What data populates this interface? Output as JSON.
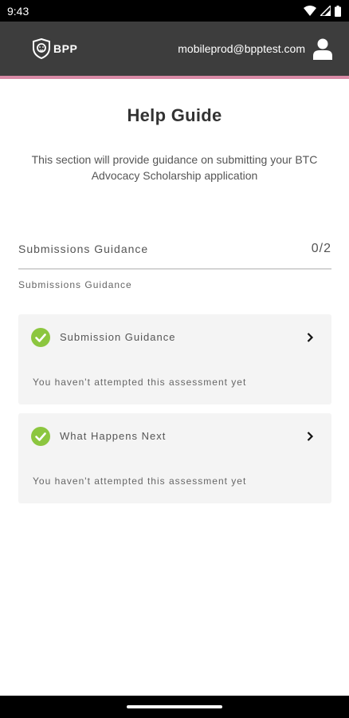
{
  "status_bar": {
    "time": "9:43",
    "icons": [
      "wifi-icon",
      "signal-icon",
      "battery-icon"
    ]
  },
  "header": {
    "brand": "BPP",
    "logo_icon": "lion-shield-icon",
    "email": "mobileprod@bpptest.com",
    "avatar_icon": "user-icon",
    "accent_color": "#d98aa6",
    "background_color": "#3d3d3d"
  },
  "page": {
    "title": "Help Guide",
    "description": "This section will provide guidance on submitting your BTC Advocacy Scholarship application"
  },
  "section": {
    "title": "Submissions Guidance",
    "count": "0/2",
    "subtitle": "Submissions Guidance"
  },
  "cards": [
    {
      "title": "Submission Guidance",
      "status": "You haven't attempted this assessment yet",
      "icon": "check-circle-icon"
    },
    {
      "title": "What Happens Next",
      "status": "You haven't attempted this assessment yet",
      "icon": "check-circle-icon"
    }
  ],
  "colors": {
    "check_green": "#8cc63f",
    "card_background": "#f4f4f4"
  }
}
